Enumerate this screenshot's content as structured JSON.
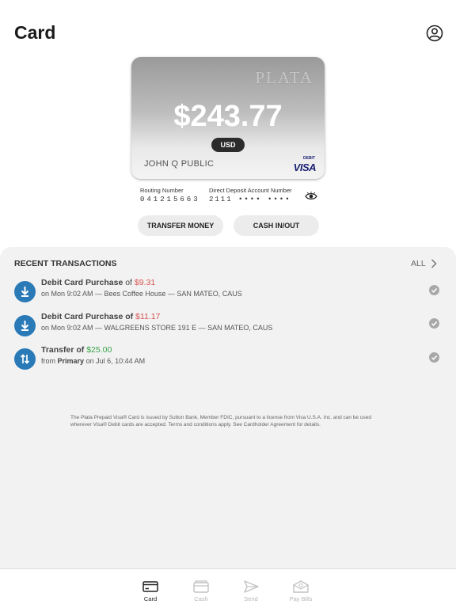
{
  "header": {
    "title": "Card"
  },
  "card": {
    "brand": "PLATA",
    "balance": "$243.77",
    "currency": "USD",
    "holder": "JOHN Q PUBLIC",
    "type": "DEBIT",
    "network": "VISA"
  },
  "account": {
    "routing_label": "Routing Number",
    "routing_value": "041215663",
    "deposit_label": "Direct Deposit Account Number",
    "deposit_value": "2111 •••• ••••"
  },
  "actions": {
    "transfer": "TRANSFER MONEY",
    "cash": "CASH IN/OUT"
  },
  "transactions": {
    "heading": "RECENT TRANSACTIONS",
    "all_label": "ALL",
    "items": [
      {
        "title": "Debit Card Purchase",
        "joiner": "of",
        "amount": "$9.31",
        "sub": "on Mon 9:02 AM — Bees Coffee House — SAN MATEO, CAUS"
      },
      {
        "title": "Debit Card Purchase of",
        "amount": "$11.17",
        "sub": "on Mon 9:02 AM — WALGREENS STORE 191 E — SAN MATEO, CAUS"
      },
      {
        "title": "Transfer of",
        "amount": "$25.00",
        "sub_prefix": "from",
        "sub_bold": "Primary",
        "sub_suffix": "on Jul 6, 10:44 AM"
      }
    ]
  },
  "disclaimer": "The Plata Prepaid Visa® Card is issued by Sutton Bank, Member FDIC, pursuant to a license from Visa U.S.A. Inc. and can be used wherever  Visa® Debit cards are accepted. Terms and conditions apply. See Cardholder Agreement for details.",
  "tabs": [
    {
      "label": "Card",
      "icon": "card-icon",
      "active": true
    },
    {
      "label": "Cash",
      "icon": "wallet-icon",
      "active": false
    },
    {
      "label": "Send",
      "icon": "send-icon",
      "active": false
    },
    {
      "label": "Pay Bills",
      "icon": "bills-icon",
      "active": false
    }
  ],
  "colors": {
    "accent": "#2a7ab8",
    "negative": "#d9534f",
    "positive": "#3aa34a"
  }
}
